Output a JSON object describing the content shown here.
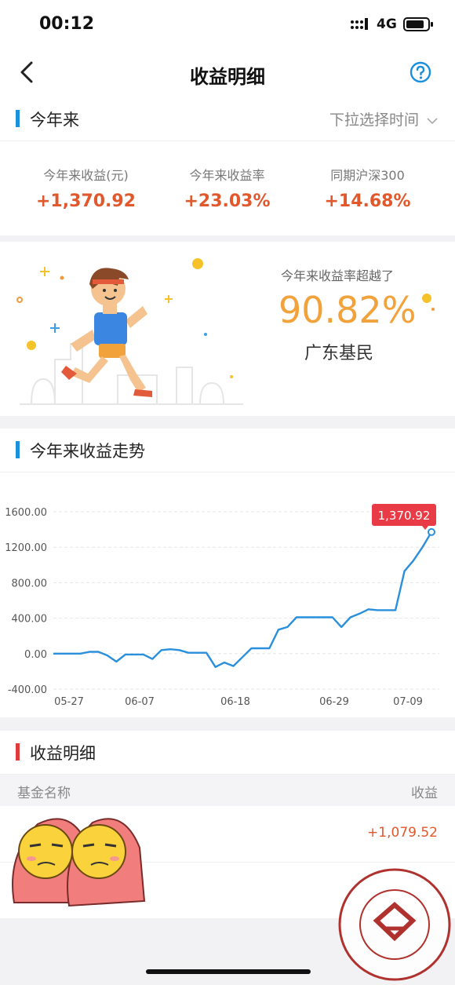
{
  "status": {
    "time": "00:12",
    "network": "4G"
  },
  "nav": {
    "title": "收益明细",
    "back_icon": "chevron-left-icon",
    "help_icon": "question-circle-icon"
  },
  "ytd_section": {
    "label": "今年来",
    "picker": "下拉选择时间"
  },
  "stats": [
    {
      "label": "今年来收益(元)",
      "value": "+1,370.92"
    },
    {
      "label": "今年来收益率",
      "value": "+23.03%"
    },
    {
      "label": "同期沪深300",
      "value": "+14.68%"
    }
  ],
  "promo": {
    "caption": "今年来收益率超越了",
    "percent": "90.82%",
    "group": "广东基民"
  },
  "trend_section": {
    "label": "今年来收益走势"
  },
  "chart_data": {
    "type": "line",
    "x_ticks": [
      "05-27",
      "06-07",
      "06-18",
      "06-29",
      "07-09"
    ],
    "y_ticks": [
      "1600.00",
      "1200.00",
      "800.00",
      "400.00",
      "0.00",
      "-400.00"
    ],
    "ylim": [
      -400,
      1600
    ],
    "grid": true,
    "tooltip": "1,370.92",
    "series": [
      {
        "values": [
          0,
          0,
          0,
          0,
          20,
          20,
          -20,
          -90,
          -10,
          -10,
          -10,
          -60,
          40,
          50,
          40,
          10,
          10,
          10,
          -150,
          -100,
          -140,
          -40,
          60,
          60,
          60,
          270,
          300,
          410,
          410,
          410,
          410,
          410,
          300,
          410,
          450,
          500,
          490,
          490,
          490,
          930,
          1050,
          1200,
          1370.92
        ]
      }
    ],
    "line_color": "#2a8fdc",
    "tooltip_color": "#e83b45"
  },
  "detail_section": {
    "label": "收益明细",
    "col_name": "基金名称",
    "col_value": "收益"
  },
  "rows": [
    {
      "value": "+1,079.52"
    },
    {
      "value": ""
    }
  ]
}
